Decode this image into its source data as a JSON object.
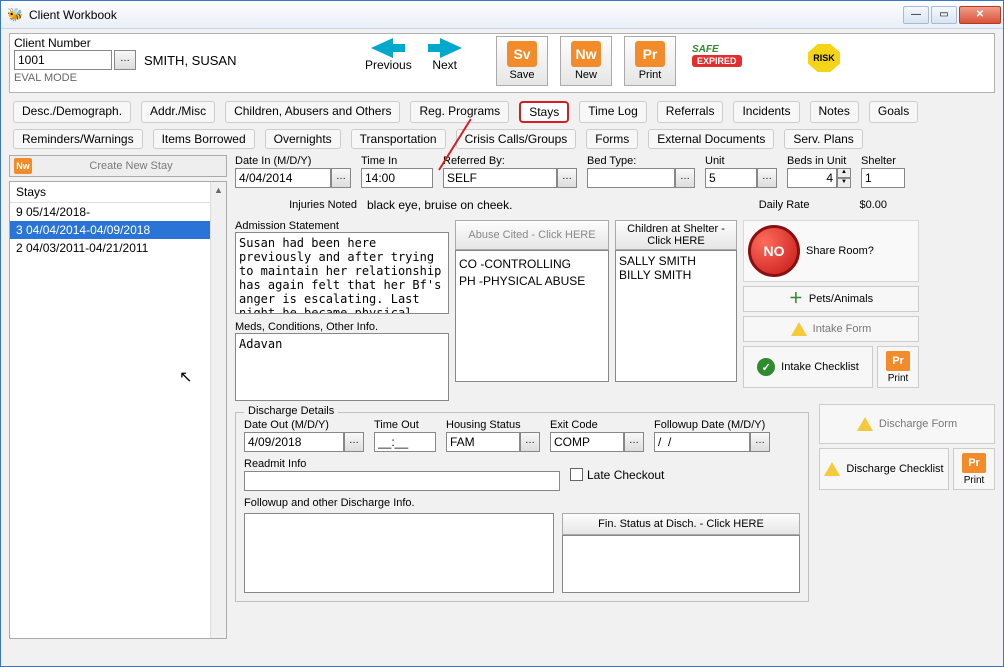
{
  "window": {
    "title": "Client Workbook"
  },
  "client": {
    "number_label": "Client Number",
    "number_value": "1001",
    "name": "SMITH, SUSAN",
    "eval": "EVAL MODE"
  },
  "nav": {
    "prev": "Previous",
    "next": "Next"
  },
  "bigbtn": {
    "save": "Save",
    "new": "New",
    "print": "Print",
    "sv": "Sv",
    "nw": "Nw",
    "pr": "Pr"
  },
  "badges": {
    "expired": "EXPIRED",
    "safe": "SAFE",
    "risk": "RISK"
  },
  "tabs1": [
    "Desc./Demograph.",
    "Addr./Misc",
    "Children, Abusers and Others",
    "Reg. Programs",
    "Stays",
    "Time Log",
    "Referrals",
    "Incidents",
    "Notes",
    "Goals"
  ],
  "tabs2": [
    "Reminders/Warnings",
    "Items Borrowed",
    "Overnights",
    "Transportation",
    "Crisis Calls/Groups",
    "Forms",
    "External Documents",
    "Serv. Plans"
  ],
  "active_tab_index": 4,
  "create_stay": {
    "nw": "Nw",
    "label": "Create New Stay"
  },
  "stays": {
    "header": "Stays",
    "items": [
      {
        "label": "9 05/14/2018-"
      },
      {
        "label": "3 04/04/2014-04/09/2018"
      },
      {
        "label": "2 04/03/2011-04/21/2011"
      }
    ],
    "selected_index": 1
  },
  "fields": {
    "date_in": {
      "label": "Date In (M/D/Y)",
      "value": "4/04/2014"
    },
    "time_in": {
      "label": "Time In",
      "value": "14:00"
    },
    "referred_by": {
      "label": "Referred By:",
      "value": "SELF"
    },
    "bed_type": {
      "label": "Bed Type:",
      "value": ""
    },
    "unit": {
      "label": "Unit",
      "value": "5"
    },
    "beds_in_unit": {
      "label": "Beds in Unit",
      "value": "4"
    },
    "shelter": {
      "label": "Shelter",
      "value": "1"
    },
    "injuries_label": "Injuries Noted",
    "injuries_value": "black eye, bruise on cheek.",
    "daily_rate_label": "Daily Rate",
    "daily_rate_value": "$0.00"
  },
  "admission": {
    "label": "Admission Statement",
    "text": "Susan had been here previously and after trying to maintain her relationship has again felt that her Bf's anger is escalating. Last night he became physical during an argument.",
    "meds_label": "Meds, Conditions, Other Info.",
    "meds_text": "Adavan"
  },
  "abuse": {
    "header": "Abuse Cited - Click HERE",
    "items": [
      "CO -CONTROLLING",
      "PH -PHYSICAL ABUSE"
    ]
  },
  "children_panel": {
    "header": "Children at Shelter - Click HERE",
    "items": [
      "SALLY SMITH",
      "BILLY SMITH"
    ]
  },
  "sidebuttons": {
    "no": "NO",
    "share": "Share Room?",
    "pets": "Pets/Animals",
    "intake_form": "Intake Form",
    "intake_checklist": "Intake Checklist",
    "print": "Print"
  },
  "discharge": {
    "legend": "Discharge Details",
    "date_out": {
      "label": "Date Out (M/D/Y)",
      "value": "4/09/2018"
    },
    "time_out": {
      "label": "Time Out",
      "value": "__:__"
    },
    "housing": {
      "label": "Housing Status",
      "value": "FAM"
    },
    "exit": {
      "label": "Exit Code",
      "value": "COMP"
    },
    "followup_date": {
      "label": "Followup Date (M/D/Y)",
      "value": "/  /"
    },
    "readmit_label": "Readmit Info",
    "readmit_value": "",
    "late_checkout": "Late Checkout",
    "followup_info_label": "Followup and other Discharge Info.",
    "followup_info_value": "",
    "fin_header": "Fin. Status at Disch. - Click HERE",
    "discharge_form": "Discharge Form",
    "discharge_checklist": "Discharge Checklist",
    "print": "Print"
  }
}
